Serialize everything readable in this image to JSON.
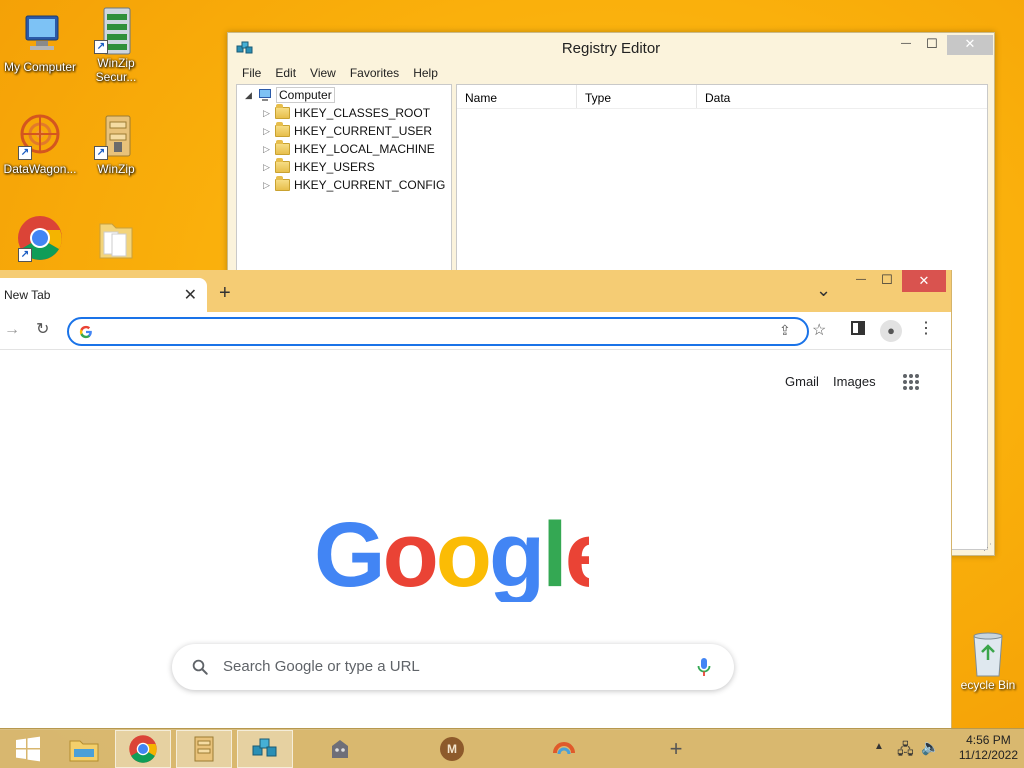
{
  "desktop": {
    "icons": [
      {
        "label": "My Computer"
      },
      {
        "label": "WinZip Secur..."
      },
      {
        "label": "DataWagon..."
      },
      {
        "label": "WinZip"
      },
      {
        "label": ""
      },
      {
        "label": ""
      }
    ],
    "recycle_bin_label": "ecycle Bin"
  },
  "regedit": {
    "title": "Registry Editor",
    "controls": {
      "minimize": "—",
      "maximize": "☐",
      "close": "✕"
    },
    "menu": [
      "File",
      "Edit",
      "View",
      "Favorites",
      "Help"
    ],
    "tree": {
      "root": "Computer",
      "keys": [
        "HKEY_CLASSES_ROOT",
        "HKEY_CURRENT_USER",
        "HKEY_LOCAL_MACHINE",
        "HKEY_USERS",
        "HKEY_CURRENT_CONFIG"
      ]
    },
    "columns": [
      "Name",
      "Type",
      "Data"
    ]
  },
  "chrome": {
    "tab_title": "New Tab",
    "tab_close": "✕",
    "new_tab": "+",
    "tab_search": "⌄",
    "controls": {
      "minimize": "—",
      "maximize": "☐",
      "close": "✕"
    },
    "omnibox_value": "",
    "links": {
      "gmail": "Gmail",
      "images": "Images"
    },
    "search_placeholder": "Search Google or type a URL",
    "colors": {
      "blue": "#4285F4",
      "red": "#EA4335",
      "yellow": "#FBBC05",
      "green": "#34A853"
    }
  },
  "taskbar": {
    "time": "4:56 PM",
    "date": "11/12/2022",
    "pinned": [
      "start",
      "file-explorer",
      "chrome",
      "winzip",
      "registry-editor",
      "app-5",
      "app-m",
      "app-7",
      "app-add"
    ],
    "m_letter": "M"
  }
}
